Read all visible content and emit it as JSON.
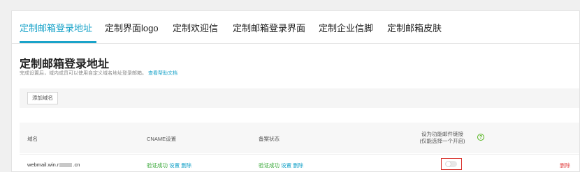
{
  "tabs": [
    {
      "label": "定制邮箱登录地址",
      "active": true
    },
    {
      "label": "定制界面logo",
      "active": false
    },
    {
      "label": "定制欢迎信",
      "active": false
    },
    {
      "label": "定制邮箱登录界面",
      "active": false
    },
    {
      "label": "定制企业信脚",
      "active": false
    },
    {
      "label": "定制邮箱皮肤",
      "active": false
    }
  ],
  "section": {
    "title": "定制邮箱登录地址",
    "description": "完成设置后，域内成员可以使用自定义域名地址登录邮箱。",
    "description_link": "查看帮助文档"
  },
  "toolbar": {
    "add_domain_label": "添加域名"
  },
  "table": {
    "headers": {
      "domain": "域名",
      "cname": "CNAME设置",
      "record": "备案状态",
      "function_link": "设为功能邮件链接",
      "function_link_note": "(仅能选择一个开启)"
    },
    "rows": [
      {
        "domain_prefix": "webmail.win.r",
        "domain_suffix": ".cn",
        "cname_status": "验证成功",
        "cname_settings": "设置",
        "cname_delete": "删除",
        "record_status": "验证成功",
        "record_settings": "设置",
        "record_delete": "删除",
        "function_link_enabled": false,
        "delete_label": "删除"
      }
    ]
  },
  "colors": {
    "accent": "#1aa3c9",
    "success": "#3aa93a",
    "danger": "#e24a4a",
    "highlight_box": "#d9302a"
  },
  "icons": {
    "help": "question-circle-icon"
  }
}
